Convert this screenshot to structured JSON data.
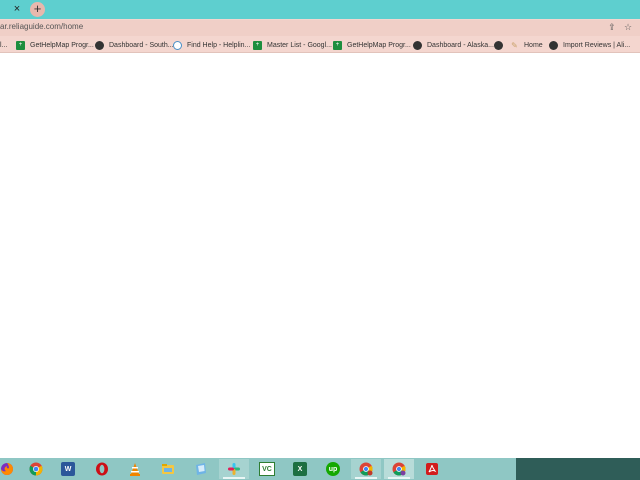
{
  "browser": {
    "tab_close_glyph": "×",
    "new_tab_glyph": "+",
    "url": "ar.reliaguide.com/home",
    "share_glyph": "⇪",
    "star_glyph": "☆"
  },
  "bookmarks": [
    {
      "label": "GetHelpMap Progr...",
      "icon": "sheets-icon"
    },
    {
      "label": "Dashboard - South...",
      "icon": "globe-icon"
    },
    {
      "label": "Find Help - Helplin...",
      "icon": "chat-bubble-icon"
    },
    {
      "label": "Master List - Googl...",
      "icon": "sheets-icon"
    },
    {
      "label": "GetHelpMap Progr...",
      "icon": "sheets-icon"
    },
    {
      "label": "Dashboard - Alaska...",
      "icon": "globe-icon"
    },
    {
      "label": "",
      "icon": "globe-icon"
    },
    {
      "label": "Home",
      "icon": "feather-icon"
    },
    {
      "label": "Import Reviews | Ali...",
      "icon": "globe-icon"
    }
  ],
  "bookmark_partial_label": "l...",
  "taskbar": {
    "apps": [
      {
        "name": "firefox",
        "color": "#e66000"
      },
      {
        "name": "chrome",
        "color": "#4285f4"
      },
      {
        "name": "word",
        "color": "#2b579a",
        "glyph": "W"
      },
      {
        "name": "opera",
        "color": "#cc0f16"
      },
      {
        "name": "vlc",
        "color": "#f08400"
      },
      {
        "name": "file-explorer",
        "color": "#f3c744"
      },
      {
        "name": "notepad",
        "color": "#6fb4e6"
      },
      {
        "name": "slack",
        "color": "#4a154b"
      },
      {
        "name": "vc",
        "color": "#2e7d32",
        "glyph": "VC"
      },
      {
        "name": "excel",
        "color": "#1d6f42",
        "glyph": "X"
      },
      {
        "name": "upwork",
        "color": "#14a800",
        "glyph": "up"
      },
      {
        "name": "chrome-profile-1",
        "color": "#4285f4"
      },
      {
        "name": "chrome-profile-2",
        "color": "#4285f4"
      },
      {
        "name": "acrobat",
        "color": "#d21c1c"
      }
    ]
  }
}
